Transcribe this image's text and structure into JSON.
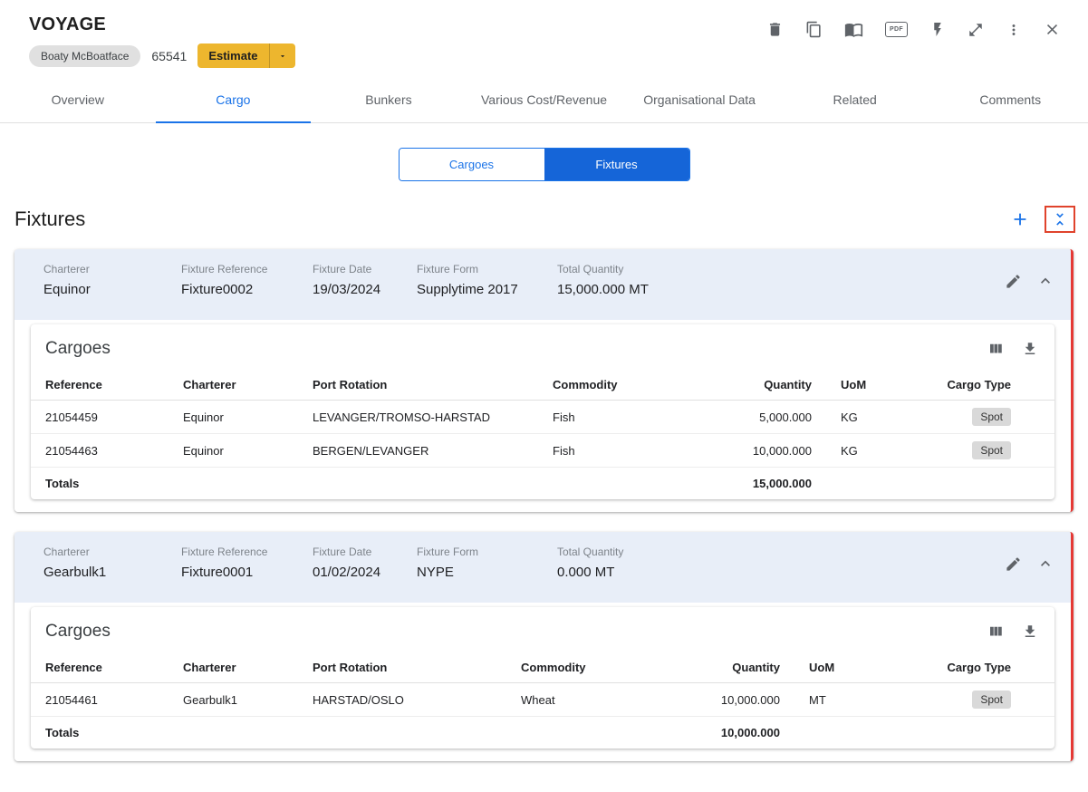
{
  "colors": {
    "accent_blue": "#1a73e8",
    "toggle_selected_blue": "#1565d8",
    "amber_button": "#edb62e",
    "card_header_blue": "#e8eef8",
    "error_red_stripe": "#e53935",
    "highlight_red_outline": "#e0432c",
    "chip_gray": "#e0e0e0"
  },
  "header": {
    "title": "VOYAGE",
    "vessel_name": "Boaty McBoatface",
    "voyage_number": "65541",
    "estimate_label": "Estimate"
  },
  "toolbar": {
    "icons": [
      "delete",
      "copy",
      "book",
      "pdf",
      "bolt",
      "expand",
      "more-options",
      "close"
    ],
    "pdf_label": "PDF"
  },
  "tabs": [
    {
      "label": "Overview",
      "active": false
    },
    {
      "label": "Cargo",
      "active": true
    },
    {
      "label": "Bunkers",
      "active": false
    },
    {
      "label": "Various Cost/Revenue",
      "active": false
    },
    {
      "label": "Organisational Data",
      "active": false
    },
    {
      "label": "Related",
      "active": false
    },
    {
      "label": "Comments",
      "active": false
    }
  ],
  "toggle": {
    "cargoes_label": "Cargoes",
    "fixtures_label": "Fixtures",
    "selected": "Fixtures"
  },
  "section": {
    "title": "Fixtures"
  },
  "labels": {
    "charterer": "Charterer",
    "fixture_reference": "Fixture Reference",
    "fixture_date": "Fixture Date",
    "fixture_form": "Fixture Form",
    "total_quantity": "Total Quantity",
    "cargoes_title": "Cargoes",
    "totals": "Totals"
  },
  "table_columns": [
    "Reference",
    "Charterer",
    "Port Rotation",
    "Commodity",
    "Quantity",
    "UoM",
    "Cargo Type"
  ],
  "fixtures": [
    {
      "charterer": "Equinor",
      "fixture_reference": "Fixture0002",
      "fixture_date": "19/03/2024",
      "fixture_form": "Supplytime 2017",
      "total_quantity": "15,000.000 MT",
      "rows": [
        {
          "reference": "21054459",
          "charterer": "Equinor",
          "port_rotation": "LEVANGER/TROMSO-HARSTAD",
          "commodity": "Fish",
          "quantity": "5,000.000",
          "uom": "KG",
          "cargo_type": "Spot"
        },
        {
          "reference": "21054463",
          "charterer": "Equinor",
          "port_rotation": "BERGEN/LEVANGER",
          "commodity": "Fish",
          "quantity": "10,000.000",
          "uom": "KG",
          "cargo_type": "Spot"
        }
      ],
      "totals_quantity": "15,000.000"
    },
    {
      "charterer": "Gearbulk1",
      "fixture_reference": "Fixture0001",
      "fixture_date": "01/02/2024",
      "fixture_form": "NYPE",
      "total_quantity": "0.000 MT",
      "rows": [
        {
          "reference": "21054461",
          "charterer": "Gearbulk1",
          "port_rotation": "HARSTAD/OSLO",
          "commodity": "Wheat",
          "quantity": "10,000.000",
          "uom": "MT",
          "cargo_type": "Spot"
        }
      ],
      "totals_quantity": "10,000.000"
    }
  ]
}
